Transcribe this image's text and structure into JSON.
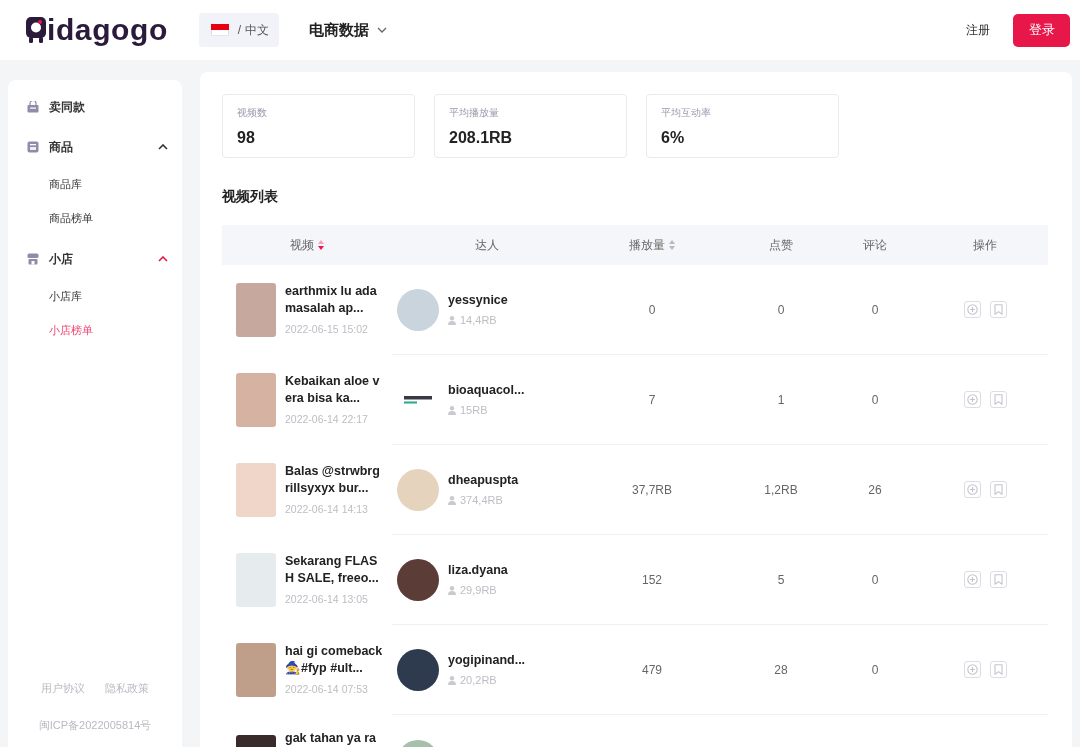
{
  "header": {
    "logo": "idagogo",
    "language": "/ 中文",
    "nav": [
      {
        "label": "电商数据"
      }
    ],
    "register": "注册",
    "login": "登录"
  },
  "sidebar": {
    "items": [
      {
        "kind": "link",
        "label": "卖同款",
        "selected": false
      },
      {
        "kind": "group",
        "label": "商品",
        "expanded": true,
        "children": [
          {
            "label": "商品库",
            "selected": false
          },
          {
            "label": "商品榜单",
            "selected": false
          }
        ]
      },
      {
        "kind": "group",
        "label": "小店",
        "expanded": true,
        "children": [
          {
            "label": "小店库",
            "selected": false
          },
          {
            "label": "小店榜单",
            "selected": true
          }
        ]
      }
    ],
    "footer": {
      "links": [
        "用户协议",
        "隐私政策"
      ],
      "icp": "闽ICP备2022005814号"
    }
  },
  "stats": [
    {
      "label": "视频数",
      "value": "98"
    },
    {
      "label": "平均播放量",
      "value": "208.1RB"
    },
    {
      "label": "平均互动率",
      "value": "6%"
    }
  ],
  "video_list": {
    "title": "视频列表",
    "table": {
      "columns": [
        {
          "label": "视频",
          "sortable": true,
          "sorted": true
        },
        {
          "label": "达人",
          "sortable": false
        },
        {
          "label": "播放量",
          "sortable": true,
          "sorted": false
        },
        {
          "label": "点赞",
          "sortable": false
        },
        {
          "label": "评论",
          "sortable": false
        },
        {
          "label": "操作",
          "sortable": false
        }
      ],
      "rows": [
        {
          "video": {
            "title": "earthmix lu ada masalah ap...",
            "date": "2022-06-15 15:02"
          },
          "creator": {
            "kind": "photo",
            "name": "yessynice",
            "fans": "14,4RB"
          },
          "plays": "0",
          "likes": "0",
          "comments": "0"
        },
        {
          "video": {
            "title": "Kebaikan aloe vera bisa ka...",
            "date": "2022-06-14 22:17"
          },
          "creator": {
            "kind": "logo",
            "name": "bioaquacol...",
            "fans": "15RB"
          },
          "plays": "7",
          "likes": "1",
          "comments": "0"
        },
        {
          "video": {
            "title": "Balas @strwbrgrillsyxyx bur...",
            "date": "2022-06-14 14:13"
          },
          "creator": {
            "kind": "photo",
            "name": "dheapuspta",
            "fans": "374,4RB"
          },
          "plays": "37,7RB",
          "likes": "1,2RB",
          "comments": "26"
        },
        {
          "video": {
            "title": "Sekarang FLASH SALE, freeo...",
            "date": "2022-06-14 13:05"
          },
          "creator": {
            "kind": "photo",
            "name": "liza.dyana",
            "fans": "29,9RB"
          },
          "plays": "152",
          "likes": "5",
          "comments": "0"
        },
        {
          "video": {
            "title": "hai gi comeback🧙#fyp #ult...",
            "date": "2022-06-14 07:53"
          },
          "creator": {
            "kind": "photo",
            "name": "yogipinand...",
            "fans": "20,2RB"
          },
          "plays": "479",
          "likes": "28",
          "comments": "0"
        },
        {
          "video": {
            "title": "gak tahan ya ra"
          },
          "creator": {
            "kind": "photo"
          }
        }
      ]
    }
  }
}
